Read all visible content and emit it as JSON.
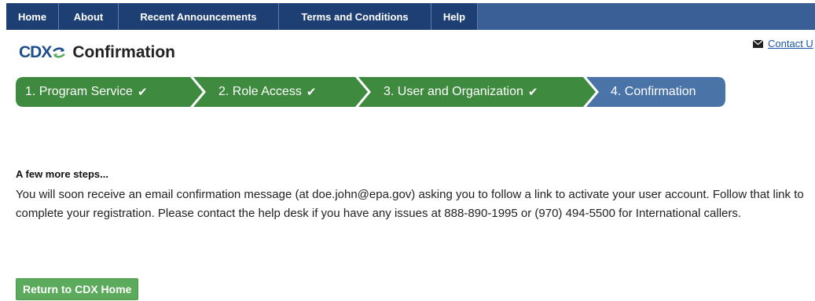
{
  "nav": {
    "items": [
      {
        "label": "Home"
      },
      {
        "label": "About"
      },
      {
        "label": "Recent Announcements"
      },
      {
        "label": "Terms and Conditions"
      },
      {
        "label": "Help"
      }
    ]
  },
  "header": {
    "logo_text": "CDX",
    "title": "Confirmation",
    "contact_label": "Contact U"
  },
  "steps": [
    {
      "label": "1. Program Service",
      "complete": true
    },
    {
      "label": "2. Role Access",
      "complete": true
    },
    {
      "label": "3. User and Organization",
      "complete": true
    },
    {
      "label": "4. Confirmation",
      "complete": false
    }
  ],
  "main": {
    "heading": "A few more steps...",
    "message": "You will soon receive an email confirmation message (at doe.john@epa.gov) asking you to follow a link to activate your user account. Follow that link to complete your registration. Please contact the help desk if you have any issues at 888-890-1995 or (970) 494-5500 for International callers.",
    "return_button": "Return to CDX Home"
  },
  "colors": {
    "nav_bg": "#1e3f73",
    "nav_bar": "#3a5e96",
    "step_complete": "#3e8a3e",
    "step_current": "#4a73a8",
    "button": "#5cab5c"
  },
  "icons": {
    "contact": "envelope-icon",
    "step_check": "checkmark-icon",
    "logo": "arrows-exchange-icon"
  }
}
